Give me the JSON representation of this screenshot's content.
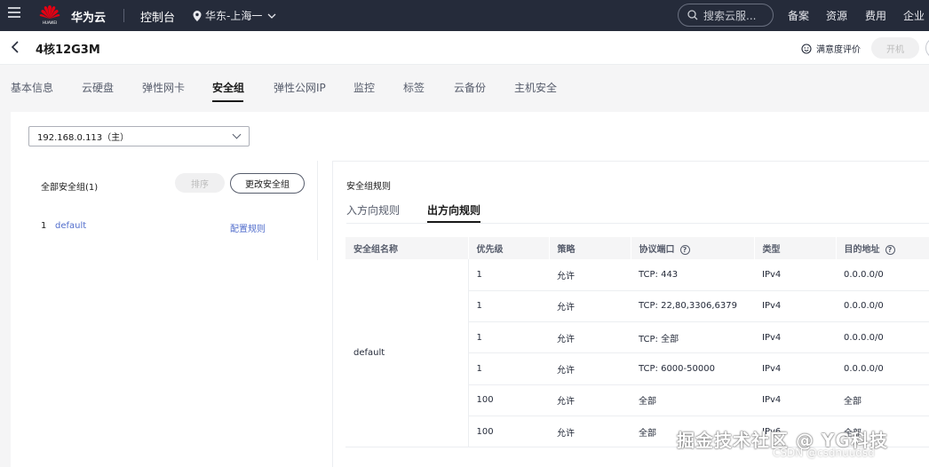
{
  "topbar": {
    "brand": "华为云",
    "logo_text": "HUAWEI",
    "console": "控制台",
    "region": "华东-上海一",
    "search_placeholder": "搜索云服...",
    "links": [
      "备案",
      "资源",
      "费用",
      "企业"
    ]
  },
  "header": {
    "back_icon": "chevron-left-icon",
    "title": "4核12G3M",
    "satisfaction": "满意度评价",
    "power_button": "开机"
  },
  "tabs": [
    "基本信息",
    "云硬盘",
    "弹性网卡",
    "安全组",
    "弹性公网IP",
    "监控",
    "标签",
    "云备份",
    "主机安全"
  ],
  "active_tab": "安全组",
  "ip_select": {
    "value": "192.168.0.113（主）"
  },
  "left_panel": {
    "all_groups": "全部安全组(1)",
    "sort_button": "排序",
    "change_button": "更改安全组",
    "groups": [
      {
        "index": "1",
        "name": "default",
        "action": "配置规则"
      }
    ]
  },
  "right_panel": {
    "title": "安全组规则",
    "tabs": [
      "入方向规则",
      "出方向规则"
    ],
    "active_tab": "出方向规则",
    "columns": [
      "安全组名称",
      "优先级",
      "策略",
      "协议端口",
      "类型",
      "目的地址"
    ],
    "group_name": "default",
    "rules": [
      {
        "priority": "1",
        "policy": "允许",
        "port": "TCP: 443",
        "type": "IPv4",
        "dest": "0.0.0.0/0"
      },
      {
        "priority": "1",
        "policy": "允许",
        "port": "TCP: 22,80,3306,6379",
        "type": "IPv4",
        "dest": "0.0.0.0/0"
      },
      {
        "priority": "1",
        "policy": "允许",
        "port": "TCP: 全部",
        "type": "IPv4",
        "dest": "0.0.0.0/0"
      },
      {
        "priority": "1",
        "policy": "允许",
        "port": "TCP: 6000-50000",
        "type": "IPv4",
        "dest": "0.0.0.0/0"
      },
      {
        "priority": "100",
        "policy": "允许",
        "port": "全部",
        "type": "IPv4",
        "dest": "全部"
      },
      {
        "priority": "100",
        "policy": "允许",
        "port": "全部",
        "type": "IPv6",
        "dest": "全部"
      }
    ]
  },
  "watermark": {
    "main": "掘金技术社区 @ YG科技",
    "sub": "CSDN @csdnuudsd"
  },
  "colors": {
    "topbar": "#252b3a",
    "link": "#526ecc",
    "active": "#191919"
  }
}
